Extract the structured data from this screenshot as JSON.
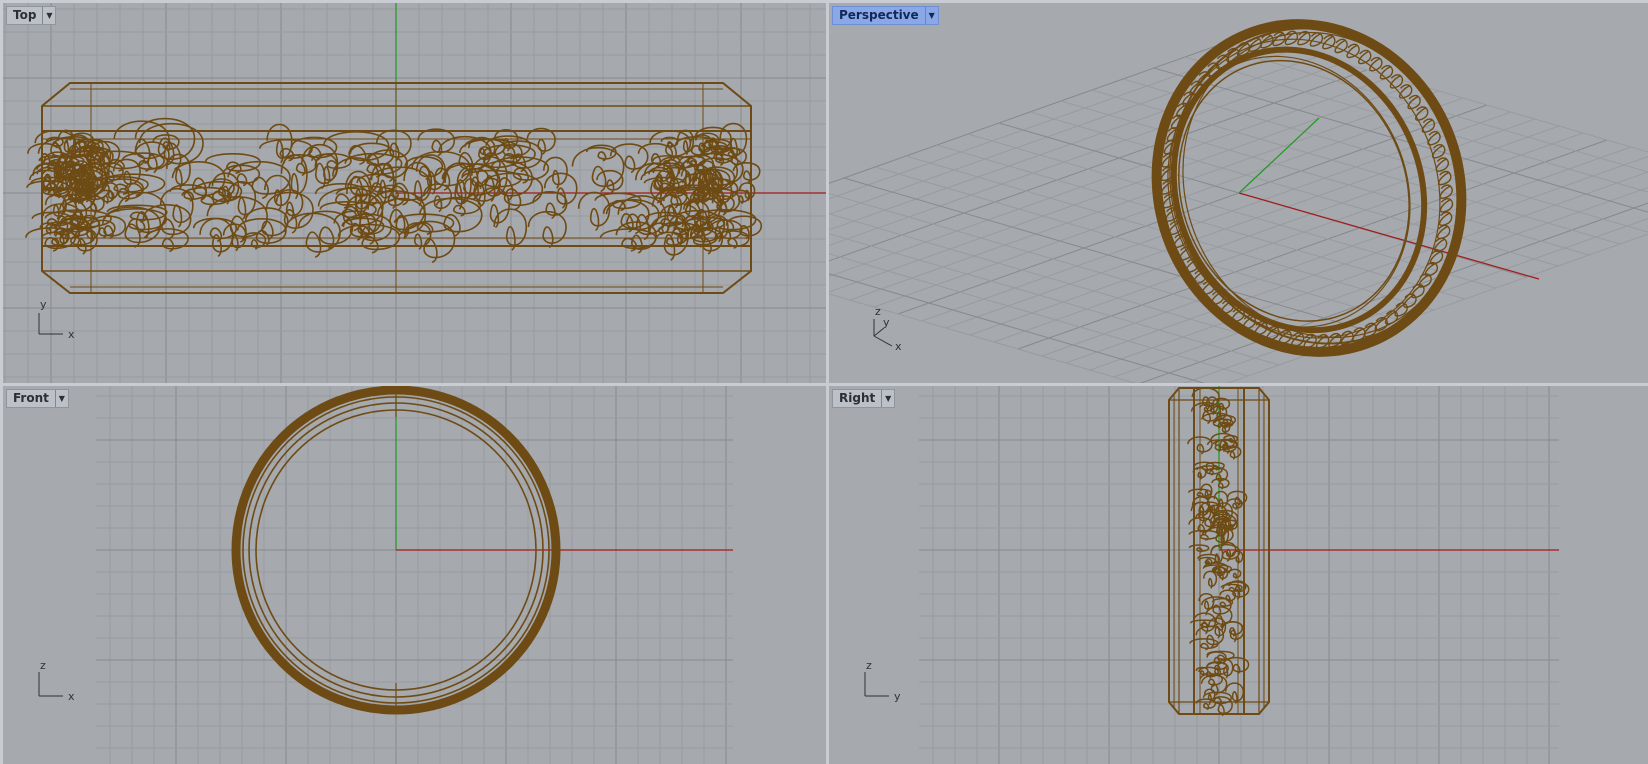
{
  "viewports": {
    "top": {
      "title": "Top"
    },
    "persp": {
      "title": "Perspective"
    },
    "front": {
      "title": "Front"
    },
    "right": {
      "title": "Right"
    }
  },
  "axis_labels": {
    "top": {
      "a": "y",
      "b": "x"
    },
    "persp": {
      "a": "z",
      "b": "y",
      "c": "x"
    },
    "front": {
      "a": "z",
      "b": "x"
    },
    "right": {
      "a": "z",
      "b": "y"
    }
  },
  "colors": {
    "viewport_bg": "#a6a9ad",
    "grid_minor": "#989ba0",
    "grid_major": "#86898e",
    "model": "#6e4b14",
    "x_axis": "#a31a1a",
    "y_axis": "#1f9a1f",
    "active_tab": "#8aa8e6"
  },
  "icons": {
    "dropdown": "chevron-down-icon"
  }
}
